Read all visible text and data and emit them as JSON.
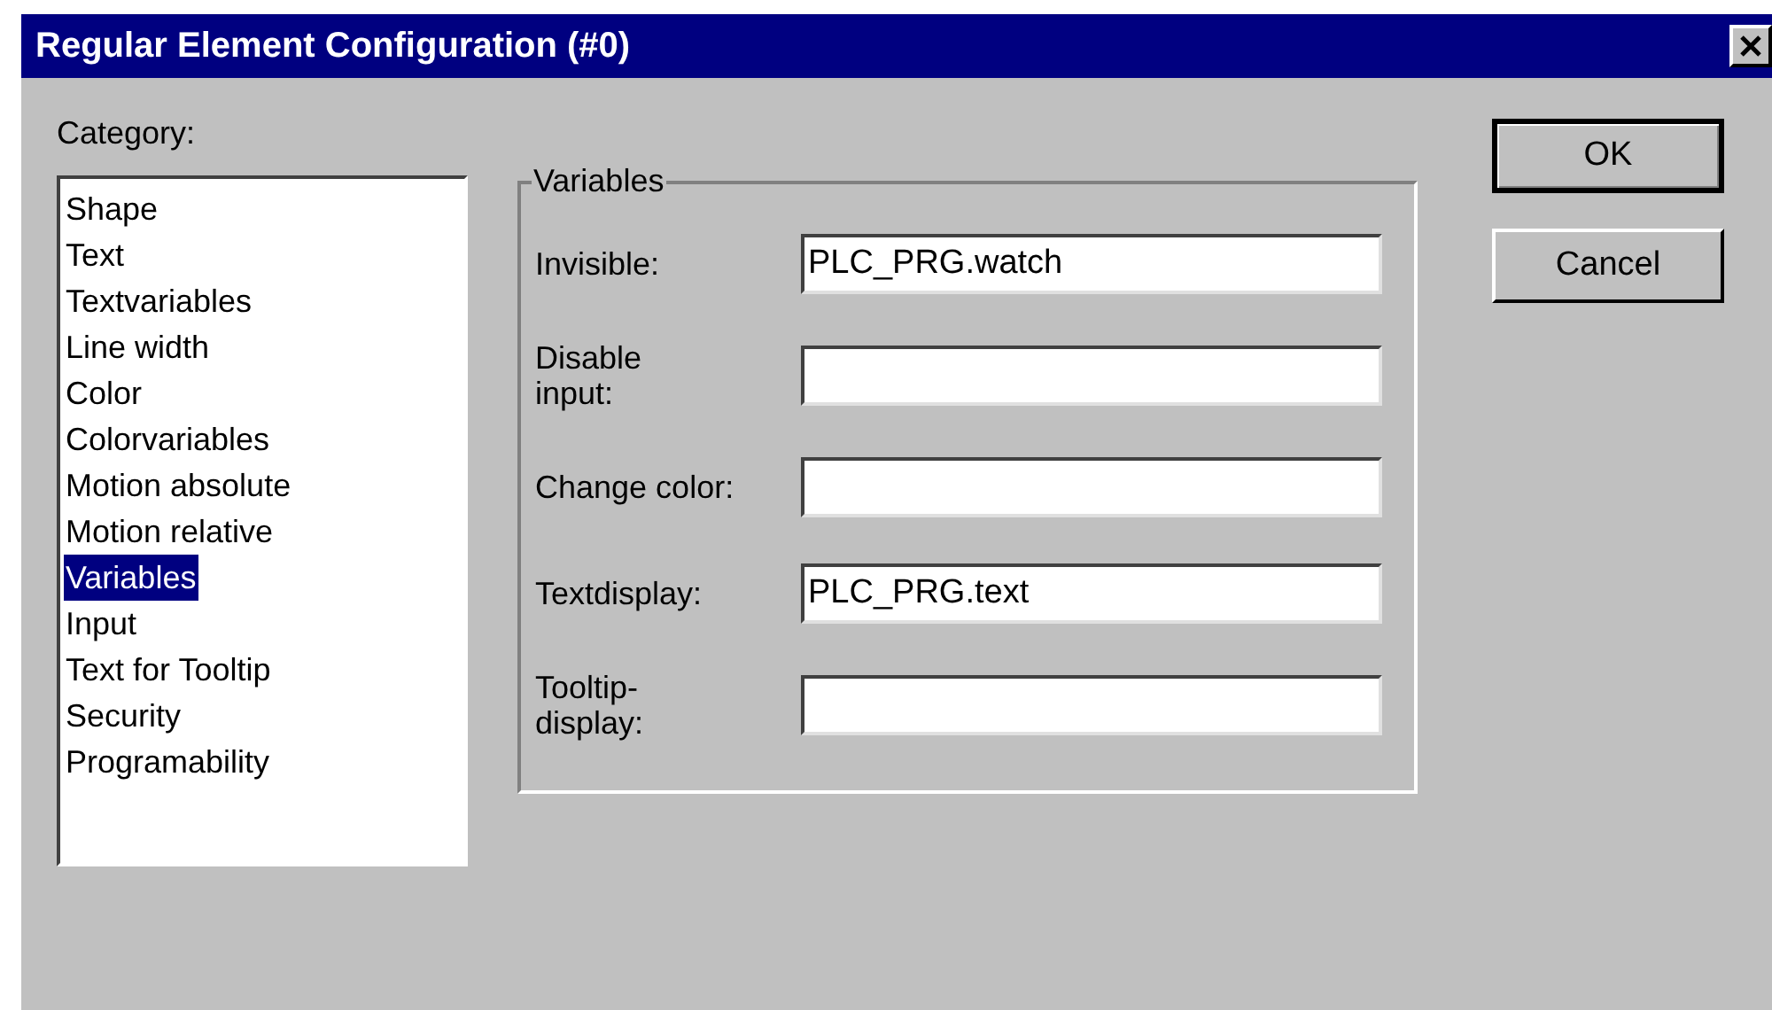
{
  "window": {
    "title": "Regular Element Configuration (#0)"
  },
  "category": {
    "label": "Category:",
    "items": [
      {
        "label": "Shape",
        "selected": false
      },
      {
        "label": "Text",
        "selected": false
      },
      {
        "label": "Textvariables",
        "selected": false
      },
      {
        "label": "Line width",
        "selected": false
      },
      {
        "label": "Color",
        "selected": false
      },
      {
        "label": "Colorvariables",
        "selected": false
      },
      {
        "label": "Motion absolute",
        "selected": false
      },
      {
        "label": "Motion relative",
        "selected": false
      },
      {
        "label": "Variables",
        "selected": true
      },
      {
        "label": "Input",
        "selected": false
      },
      {
        "label": "Text for Tooltip",
        "selected": false
      },
      {
        "label": "Security",
        "selected": false
      },
      {
        "label": "Programability",
        "selected": false
      }
    ]
  },
  "group": {
    "title": "Variables",
    "fields": [
      {
        "label": "Invisible:",
        "value": "PLC_PRG.watch"
      },
      {
        "label": "Disable\ninput:"
      },
      {
        "label": "Change color:"
      },
      {
        "label": "Textdisplay:",
        "value": "PLC_PRG.text"
      },
      {
        "label": "Tooltip-\ndisplay:"
      }
    ]
  },
  "buttons": [
    {
      "label": "OK",
      "default": true
    },
    {
      "label": "Cancel",
      "default": false
    }
  ]
}
